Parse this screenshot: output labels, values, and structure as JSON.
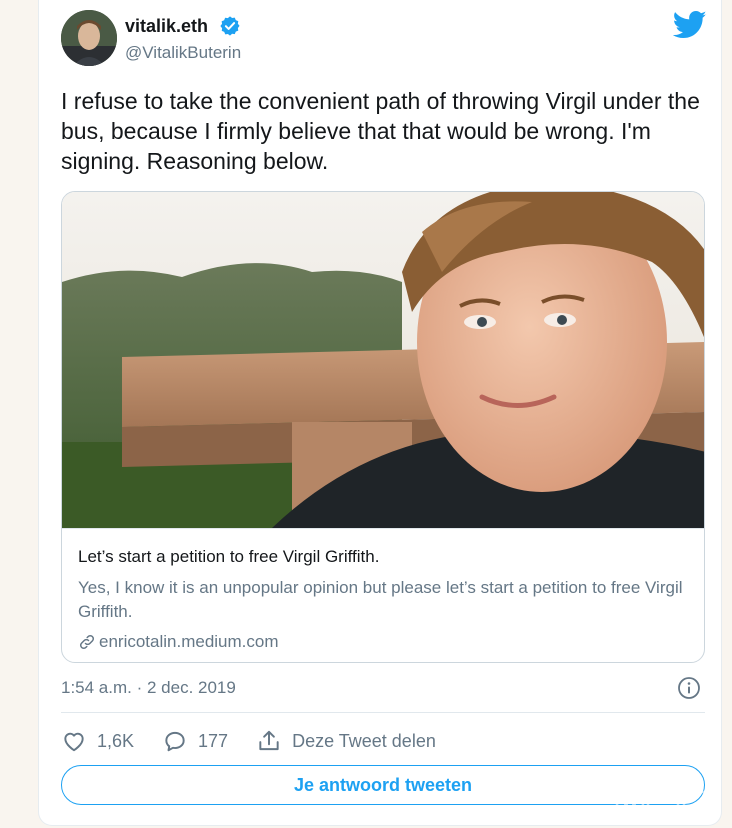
{
  "author": {
    "display_name": "vitalik.eth",
    "handle": "@VitalikButerin"
  },
  "tweet": {
    "text": "I refuse to take the convenient path of throwing Virgil under the bus, because I firmly believe that that would be wrong. I'm signing. Reasoning below."
  },
  "link_card": {
    "title": "Let’s start a petition to free Virgil Griffith.",
    "description": "Yes, I know it is an unpopular opinion but please let’s start a petition to free Virgil Griffith.",
    "domain": "enricotalin.medium.com"
  },
  "meta": {
    "timestamp": "1:54 a.m. · 2 dec. 2019"
  },
  "actions": {
    "likes": "1,6K",
    "replies": "177",
    "share_label": "Deze Tweet delen"
  },
  "reply_button": {
    "label": "Je antwoord tweeten"
  },
  "icons": [
    "verified-icon",
    "twitter-logo-icon",
    "link-icon",
    "info-icon",
    "heart-icon",
    "reply-icon",
    "share-icon"
  ],
  "colors": {
    "accent": "#1da1f2",
    "muted_text": "#657786",
    "border": "#ccd6dd"
  }
}
